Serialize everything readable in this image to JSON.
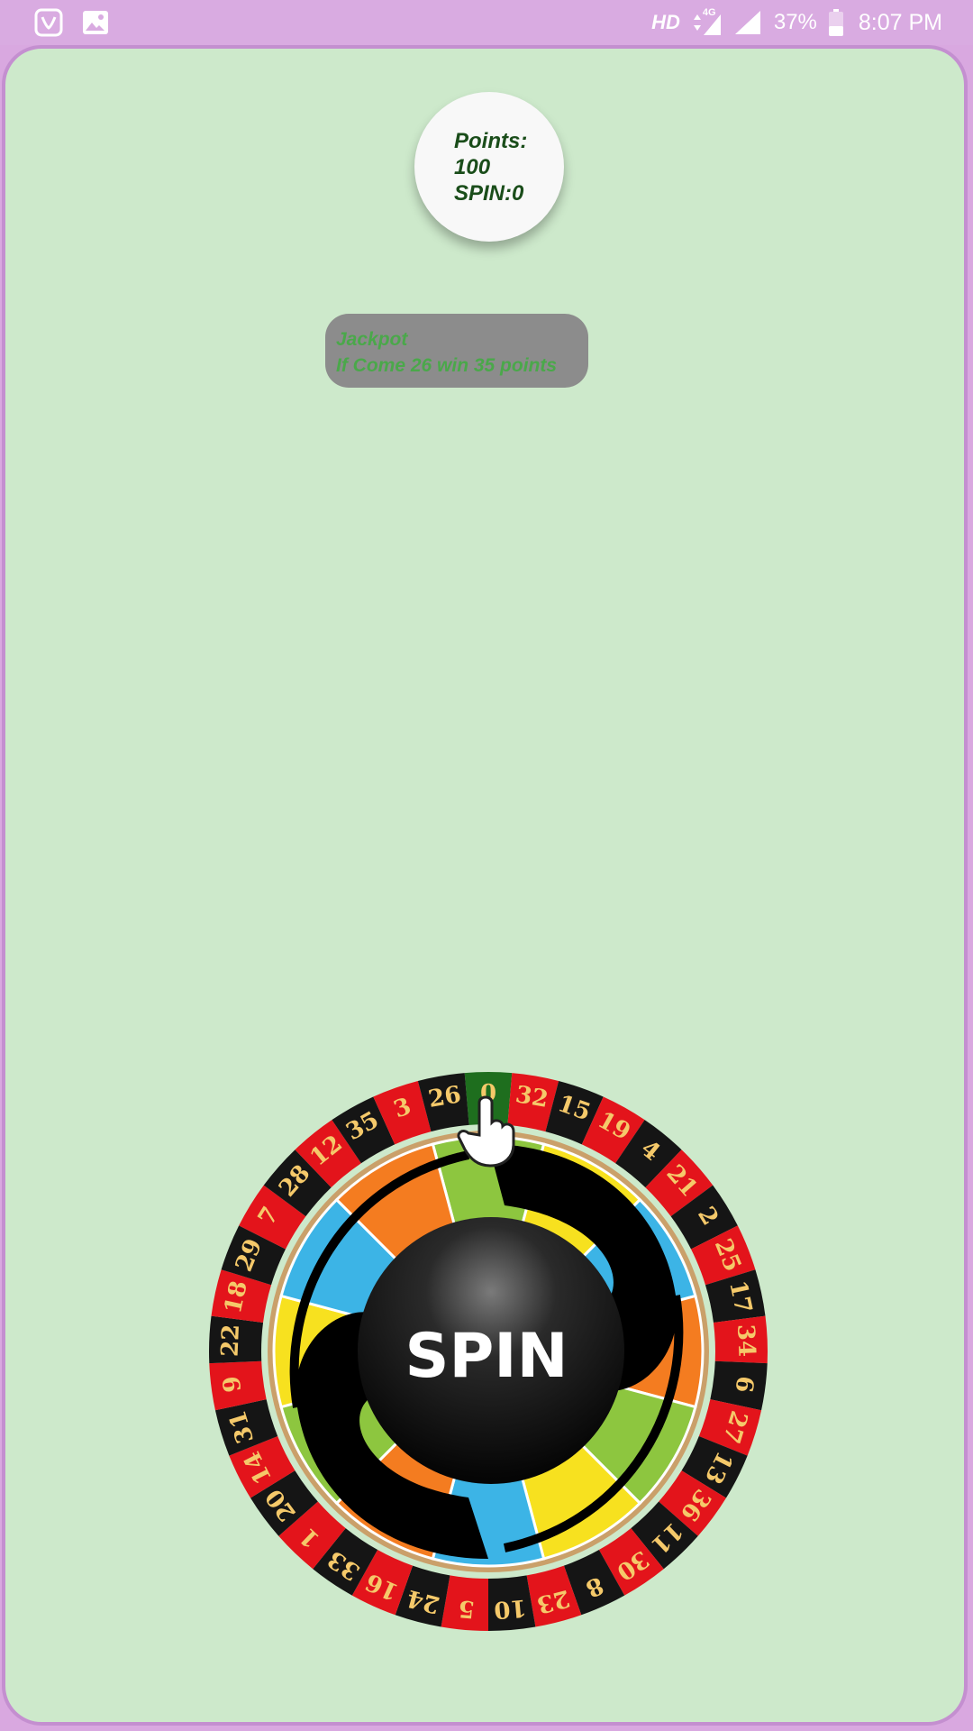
{
  "status_bar": {
    "network_label": "HD",
    "network_type": "4G",
    "battery_percent": "37%",
    "time": "8:07 PM",
    "icons": [
      "saavn-app-icon",
      "gallery-icon",
      "data-arrows-icon",
      "signal-icon",
      "signal-icon-2",
      "battery-icon"
    ],
    "text_color": "#ffffff",
    "background": "#d9abe1"
  },
  "game": {
    "background": "#cde9cb",
    "border_color": "#c48fd0",
    "points_label": "Points:",
    "points_value": "100",
    "spin_label": "SPIN:0",
    "jackpot_title": "Jackpot",
    "jackpot_text": "If Come 26 win 35 points",
    "spin_button_label": "SPIN",
    "pointer_icon": "hand-pointer-icon",
    "wheel": {
      "numbers": [
        "0",
        "32",
        "15",
        "19",
        "4",
        "21",
        "2",
        "25",
        "17",
        "34",
        "6",
        "27",
        "13",
        "36",
        "11",
        "30",
        "8",
        "23",
        "10",
        "5",
        "24",
        "16",
        "33",
        "1",
        "20",
        "14",
        "31",
        "9",
        "22",
        "18",
        "29",
        "7",
        "28",
        "12",
        "35",
        "3",
        "26"
      ],
      "colors": {
        "green": "#1e6e1e",
        "red": "#e3141b",
        "black": "#151515",
        "number_text": "#f5c96a"
      },
      "inner_segment_colors": [
        "#8dc63f",
        "#f7e11f",
        "#3cb4e6",
        "#f47c20"
      ]
    }
  }
}
